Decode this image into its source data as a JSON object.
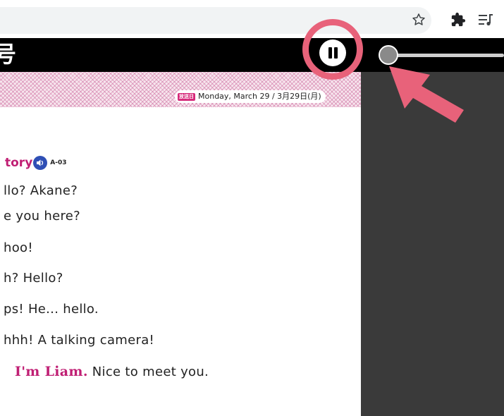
{
  "browser": {
    "icons": [
      "star-icon",
      "extensions-puzzle-icon",
      "media-queue-icon"
    ]
  },
  "player": {
    "title_fragment": "号",
    "pause_icon": "pause-icon",
    "highlight_color": "#e8627a",
    "seek_progress": 0
  },
  "header": {
    "tag": "放送日",
    "date": "Monday, March 29 / 3月29日(月)"
  },
  "story": {
    "title": "tory",
    "track": "A-03",
    "audio_icon": "speaker-icon",
    "lines": [
      {
        "text": "llo?  Akane?"
      },
      {
        "text": "e you here?"
      },
      {
        "text": "hoo!"
      },
      {
        "text": "h?  Hello?"
      },
      {
        "text": "ps!  He... hello."
      },
      {
        "text": "hhh!  A talking camera!"
      },
      {
        "speaker": "I'm Liam.",
        "text": "  Nice to meet you."
      }
    ]
  },
  "colors": {
    "accent": "#c01f74",
    "player_bar": "#000000",
    "side_panel": "#3a3a3a",
    "audio_badge": "#2f4fb5"
  }
}
